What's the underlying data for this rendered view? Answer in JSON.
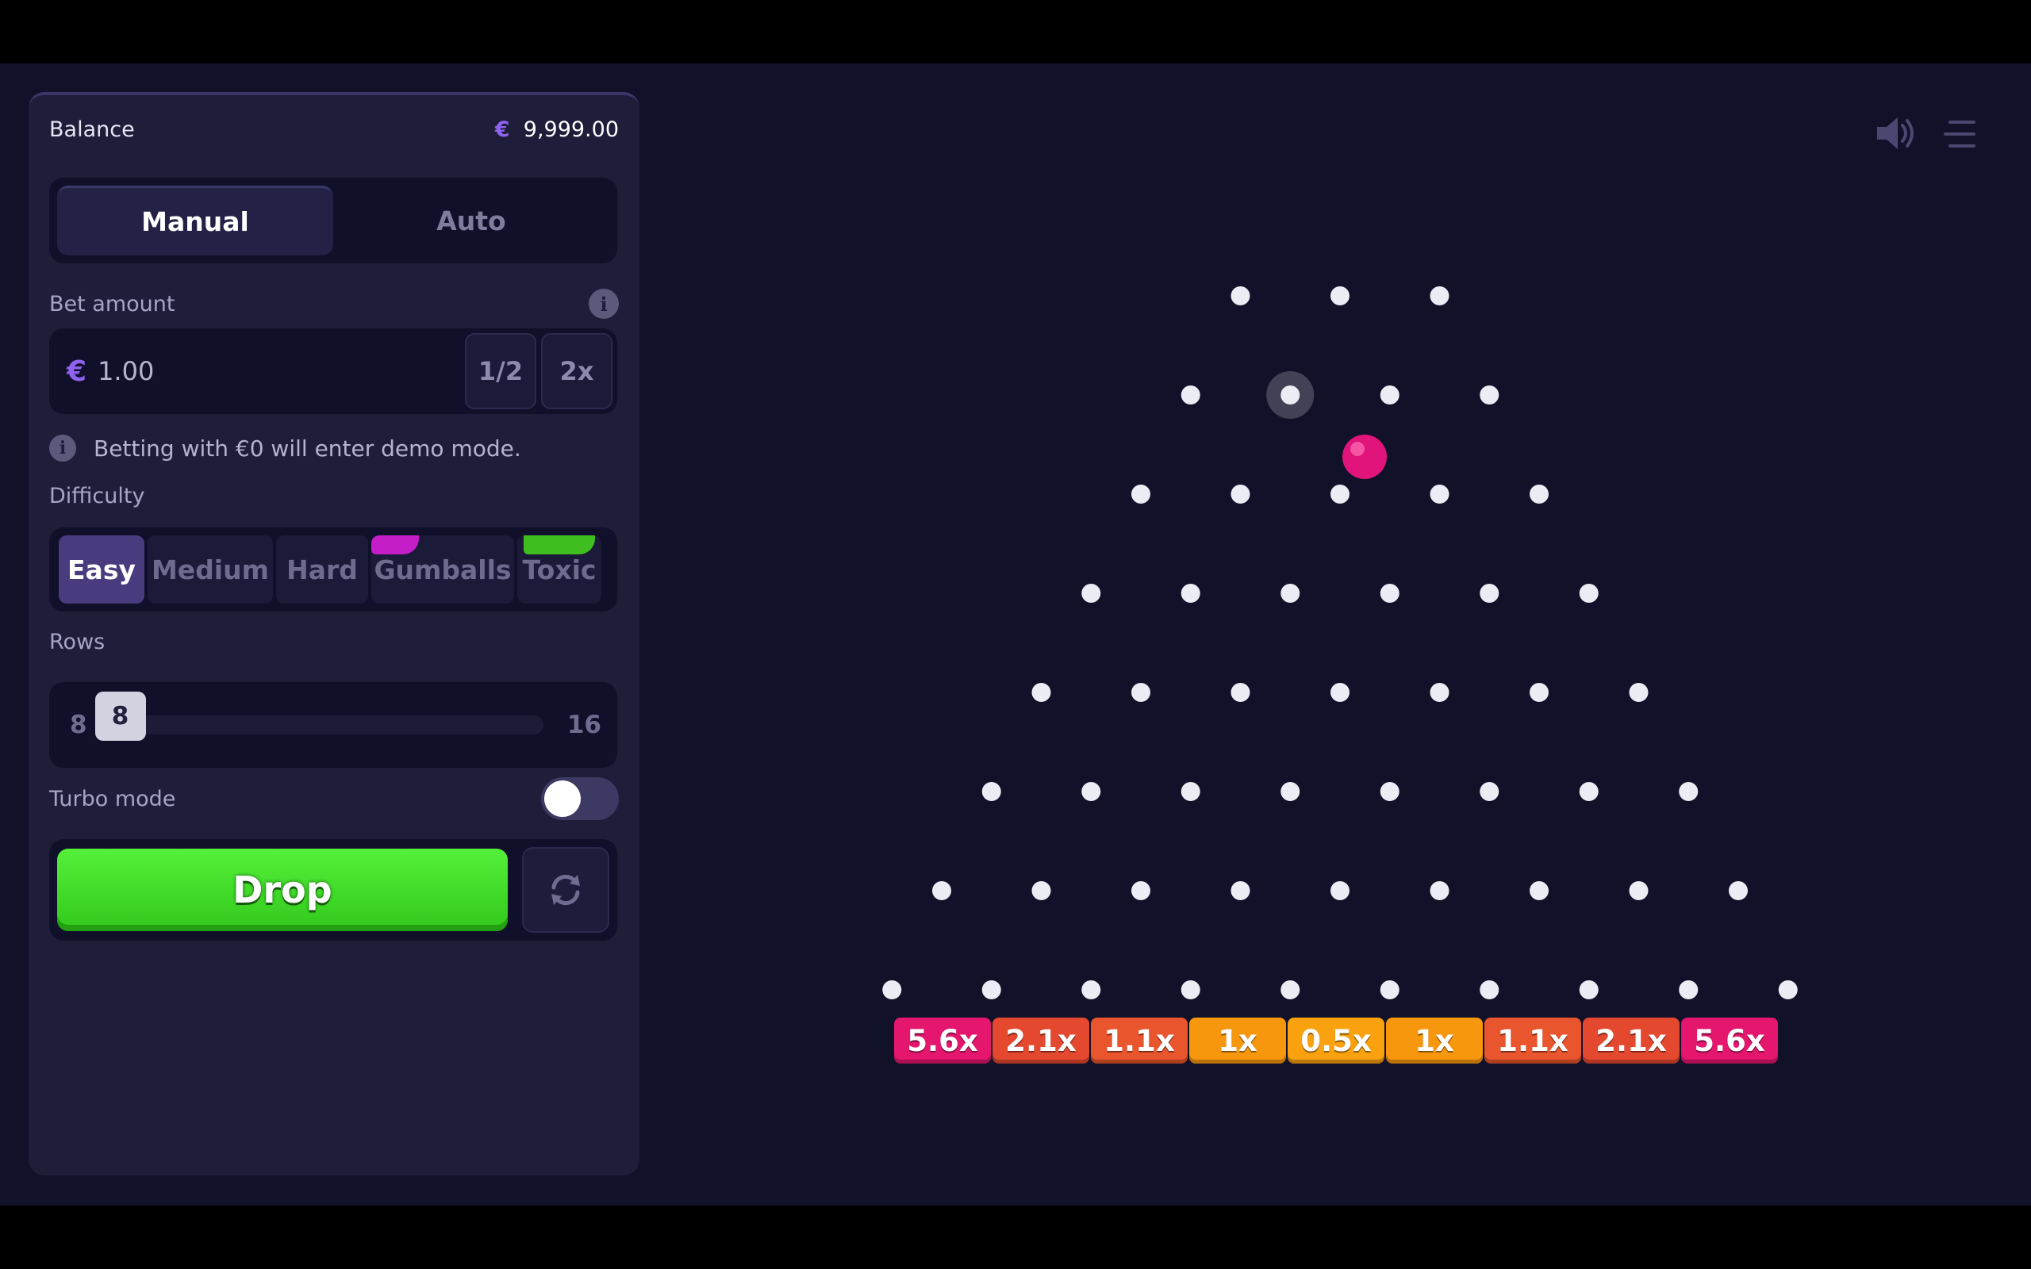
{
  "balance": {
    "label": "Balance",
    "currency": "€",
    "amount": "9,999.00"
  },
  "mode_tabs": {
    "manual": "Manual",
    "auto": "Auto",
    "active": "Manual"
  },
  "bet": {
    "label": "Bet amount",
    "info_icon": "info-icon",
    "currency": "€",
    "value": "1.00",
    "half_label": "1/2",
    "double_label": "2x",
    "note": "Betting with €0 will enter demo mode."
  },
  "difficulty": {
    "label": "Difficulty",
    "options": [
      "Easy",
      "Medium",
      "Hard",
      "Gumballs",
      "Toxic"
    ],
    "active": "Easy"
  },
  "rows": {
    "label": "Rows",
    "min": "8",
    "max": "16",
    "value": "8"
  },
  "turbo": {
    "label": "Turbo mode",
    "enabled": false
  },
  "drop_label": "Drop",
  "board": {
    "peg_rows": 8,
    "multipliers": [
      "5.6x",
      "2.1x",
      "1.1x",
      "1x",
      "0.5x",
      "1x",
      "1.1x",
      "2.1x",
      "5.6x"
    ],
    "multiplier_colors": [
      "#e4166e",
      "#e4482f",
      "#e9552c",
      "#f7970e",
      "#f9a10f",
      "#f7970e",
      "#e9552c",
      "#e4482f",
      "#e4166e"
    ],
    "ball_color": "#e0147a"
  },
  "icons": {
    "sound": "speaker-icon",
    "menu": "menu-icon",
    "refresh": "refresh-icon"
  },
  "colors": {
    "background": "#12112a",
    "panel": "#1e1d3a",
    "drop_button": "#3ddb23",
    "accent": "#8f63f0"
  }
}
